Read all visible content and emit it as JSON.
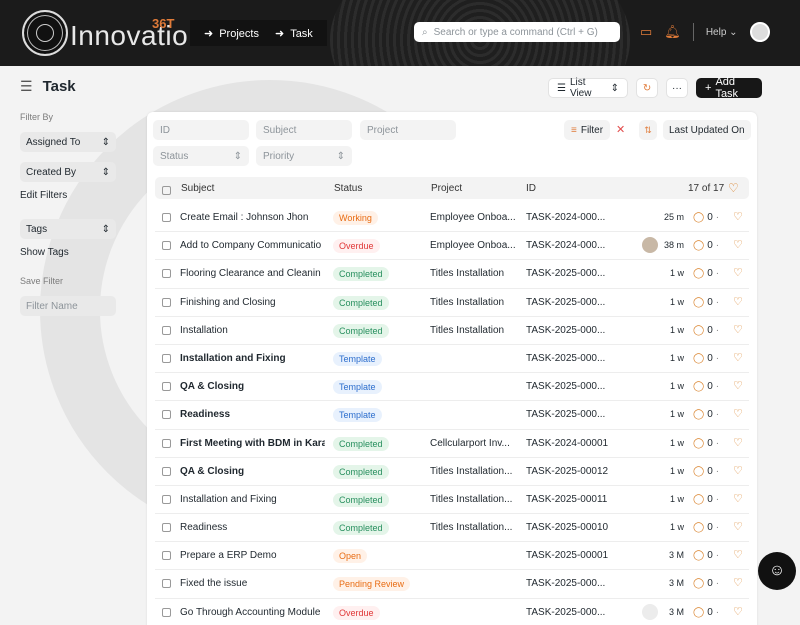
{
  "nav": {
    "logo_text": "Innovation",
    "logo_badge": "36T",
    "crumbs": [
      "Projects",
      "Task"
    ],
    "search_placeholder": "Search or type a command (Ctrl + G)",
    "help": "Help"
  },
  "page": {
    "title": "Task"
  },
  "toolbar": {
    "view": "List View",
    "add": "Add Task"
  },
  "sidebar": {
    "filter_by": "Filter By",
    "assigned_to": "Assigned To",
    "created_by": "Created By",
    "edit_filters": "Edit Filters",
    "tags": "Tags",
    "show_tags": "Show Tags",
    "save_filter": "Save Filter",
    "filter_name_placeholder": "Filter Name"
  },
  "filters": {
    "id": "ID",
    "subject": "Subject",
    "project": "Project",
    "status": "Status",
    "priority": "Priority",
    "filter": "Filter",
    "sort": "Last Updated On"
  },
  "columns": {
    "subject": "Subject",
    "status": "Status",
    "project": "Project",
    "id": "ID",
    "count": "17 of 17"
  },
  "rows": [
    {
      "subject": "Create Email : Johnson Jhon",
      "bold": false,
      "status": "Working",
      "cls": "s-working",
      "project": "Employee Onboa...",
      "id": "TASK-2024-000...",
      "time": "25 m",
      "comments": "0",
      "avatar": ""
    },
    {
      "subject": "Add to Company Communicatio",
      "bold": false,
      "status": "Overdue",
      "cls": "s-overdue",
      "project": "Employee Onboa...",
      "id": "TASK-2024-000...",
      "time": "38 m",
      "comments": "0",
      "avatar": "photo"
    },
    {
      "subject": "Flooring Clearance and Cleanin",
      "bold": false,
      "status": "Completed",
      "cls": "s-completed",
      "project": "Titles Installation",
      "id": "TASK-2025-000...",
      "time": "1 w",
      "comments": "0",
      "avatar": ""
    },
    {
      "subject": "Finishing and Closing",
      "bold": false,
      "status": "Completed",
      "cls": "s-completed",
      "project": "Titles Installation",
      "id": "TASK-2025-000...",
      "time": "1 w",
      "comments": "0",
      "avatar": ""
    },
    {
      "subject": "Installation",
      "bold": false,
      "status": "Completed",
      "cls": "s-completed",
      "project": "Titles Installation",
      "id": "TASK-2025-000...",
      "time": "1 w",
      "comments": "0",
      "avatar": ""
    },
    {
      "subject": "Installation and Fixing",
      "bold": true,
      "status": "Template",
      "cls": "s-template",
      "project": "",
      "id": "TASK-2025-000...",
      "time": "1 w",
      "comments": "0",
      "avatar": ""
    },
    {
      "subject": "QA & Closing",
      "bold": true,
      "status": "Template",
      "cls": "s-template",
      "project": "",
      "id": "TASK-2025-000...",
      "time": "1 w",
      "comments": "0",
      "avatar": ""
    },
    {
      "subject": "Readiness",
      "bold": true,
      "status": "Template",
      "cls": "s-template",
      "project": "",
      "id": "TASK-2025-000...",
      "time": "1 w",
      "comments": "0",
      "avatar": ""
    },
    {
      "subject": "First Meeting with BDM in Kara",
      "bold": true,
      "status": "Completed",
      "cls": "s-completed",
      "project": "Cellcularport Inv...",
      "id": "TASK-2024-00001",
      "time": "1 w",
      "comments": "0",
      "avatar": ""
    },
    {
      "subject": "QA & Closing",
      "bold": true,
      "status": "Completed",
      "cls": "s-completed",
      "project": "Titles Installation...",
      "id": "TASK-2025-00012",
      "time": "1 w",
      "comments": "0",
      "avatar": ""
    },
    {
      "subject": "Installation and Fixing",
      "bold": false,
      "status": "Completed",
      "cls": "s-completed",
      "project": "Titles Installation...",
      "id": "TASK-2025-00011",
      "time": "1 w",
      "comments": "0",
      "avatar": ""
    },
    {
      "subject": "Readiness",
      "bold": false,
      "status": "Completed",
      "cls": "s-completed",
      "project": "Titles Installation...",
      "id": "TASK-2025-00010",
      "time": "1 w",
      "comments": "0",
      "avatar": ""
    },
    {
      "subject": "Prepare a ERP Demo",
      "bold": false,
      "status": "Open",
      "cls": "s-open",
      "project": "",
      "id": "TASK-2025-00001",
      "time": "3 M",
      "comments": "0",
      "avatar": ""
    },
    {
      "subject": "Fixed the issue",
      "bold": false,
      "status": "Pending Review",
      "cls": "s-pending",
      "project": "",
      "id": "TASK-2025-000...",
      "time": "3 M",
      "comments": "0",
      "avatar": ""
    },
    {
      "subject": "Go Through Accounting Module",
      "bold": false,
      "status": "Overdue",
      "cls": "s-overdue",
      "project": "",
      "id": "TASK-2025-000...",
      "time": "3 M",
      "comments": "0",
      "avatar": "light"
    }
  ]
}
